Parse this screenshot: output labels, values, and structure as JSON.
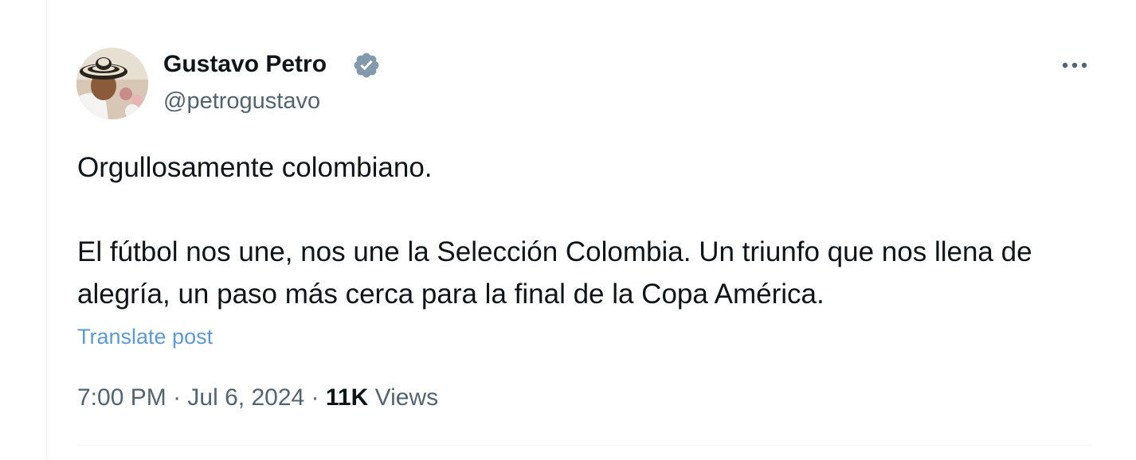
{
  "author": {
    "display_name": "Gustavo Petro",
    "handle": "@petrogustavo",
    "verified_badge": "verified-badge-gray"
  },
  "post": {
    "paragraphs": [
      "Orgullosamente colombiano.",
      "El fútbol nos une, nos une la Selección Colombia. Un triunfo que nos llena de alegría, un paso más cerca para la final de la Copa América."
    ],
    "translate_label": "Translate post"
  },
  "meta": {
    "time": "7:00 PM",
    "separator": "·",
    "date": "Jul 6, 2024",
    "views_count": "11K",
    "views_label": "Views"
  },
  "icons": {
    "more": "more-horizontal-icon",
    "verified": "verified-icon"
  },
  "colors": {
    "text_primary": "#0f1419",
    "text_secondary": "#536471",
    "link": "#5c9ad5",
    "verified_badge": "#829aab",
    "border": "#eff3f4"
  }
}
